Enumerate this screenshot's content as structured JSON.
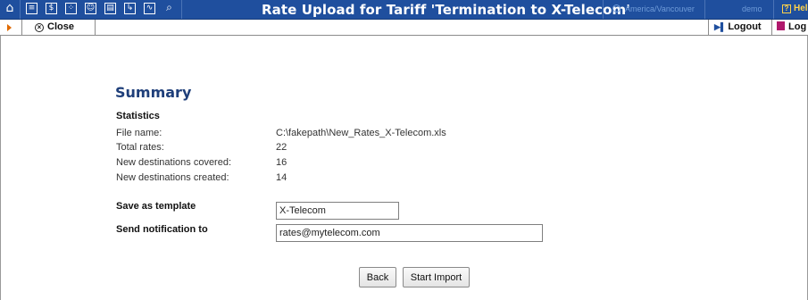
{
  "header": {
    "title": "Rate Upload for Tariff 'Termination to X-Telecom'",
    "timezone": "America/Vancouver",
    "user": "demo",
    "help_label": "Hel",
    "icons": [
      "home-icon",
      "list-icon",
      "dollar-icon",
      "grid-icon",
      "person-icon",
      "report-icon",
      "export-icon",
      "chart-icon",
      "search-icon"
    ]
  },
  "toolbar": {
    "close_label": "Close",
    "logout_label": "Logout",
    "log_label": "Log"
  },
  "summary": {
    "heading": "Summary",
    "stats_heading": "Statistics",
    "rows": [
      {
        "label": "File name:",
        "value": "C:\\fakepath\\New_Rates_X-Telecom.xls"
      },
      {
        "label": "Total rates:",
        "value": "22"
      },
      {
        "label": "New destinations covered:",
        "value": "16"
      },
      {
        "label": "New destinations created:",
        "value": "14"
      }
    ]
  },
  "form": {
    "template_label": "Save as template",
    "template_value": "X-Telecom",
    "notify_label": "Send notification to",
    "notify_value": "rates@mytelecom.com"
  },
  "buttons": {
    "back": "Back",
    "start_import": "Start Import"
  },
  "colors": {
    "header_bg": "#1f4f9e",
    "heading": "#1f3f7a",
    "help": "#ffd24a",
    "accent_orange": "#e06a00"
  }
}
